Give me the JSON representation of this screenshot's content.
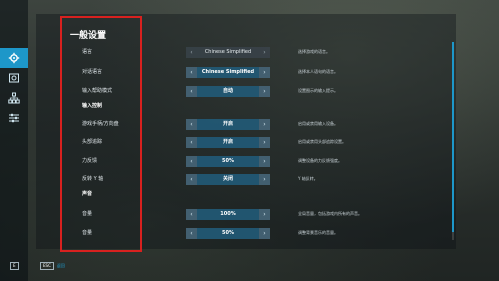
{
  "sidebar": {
    "items": [
      {
        "icon": "gear-icon",
        "active": true
      },
      {
        "icon": "gamepad-icon",
        "active": false
      },
      {
        "icon": "network-icon",
        "active": false
      },
      {
        "icon": "sliders-icon",
        "active": false
      }
    ]
  },
  "page_title": "一般设置",
  "rows": [
    {
      "type": "setting",
      "label": "语言",
      "value": "Chinese Simplified",
      "style": "plain",
      "desc": "选择游戏的语言。"
    },
    {
      "type": "setting",
      "label": "对话语言",
      "value": "Chinese Simplified",
      "style": "box",
      "desc": "选择本人语句的语言。"
    },
    {
      "type": "setting",
      "label": "输入帮助模式",
      "value": "自动",
      "style": "box",
      "desc": "设置图示的输入提示。"
    },
    {
      "type": "section",
      "label": "输入控制"
    },
    {
      "type": "setting",
      "label": "游戏手柄/方向盘",
      "value": "开启",
      "style": "box",
      "desc": "启用或禁用输入设备。"
    },
    {
      "type": "setting",
      "label": "头部追踪",
      "value": "开启",
      "style": "box",
      "desc": "启用或禁用头部追踪设置。"
    },
    {
      "type": "setting",
      "label": "力反馈",
      "value": "50%",
      "style": "box",
      "desc": "调整设备的力反馈强度。"
    },
    {
      "type": "setting",
      "label": "反转 Y 轴",
      "value": "关闭",
      "style": "box",
      "desc": "Y 轴反转。"
    },
    {
      "type": "section",
      "label": "声音"
    },
    {
      "type": "setting",
      "label": "音量",
      "value": "100%",
      "style": "box",
      "desc": "全局音量，包括游戏内所有的声音。"
    },
    {
      "type": "setting",
      "label": "音量",
      "value": "50%",
      "style": "box",
      "desc": "调整背景音乐的音量。"
    }
  ],
  "footer": {
    "back_key": "E",
    "esc_key": "ESC",
    "esc_label": "返回"
  },
  "colors": {
    "accent": "#1d97c9",
    "highlight_border": "#d8211f"
  }
}
